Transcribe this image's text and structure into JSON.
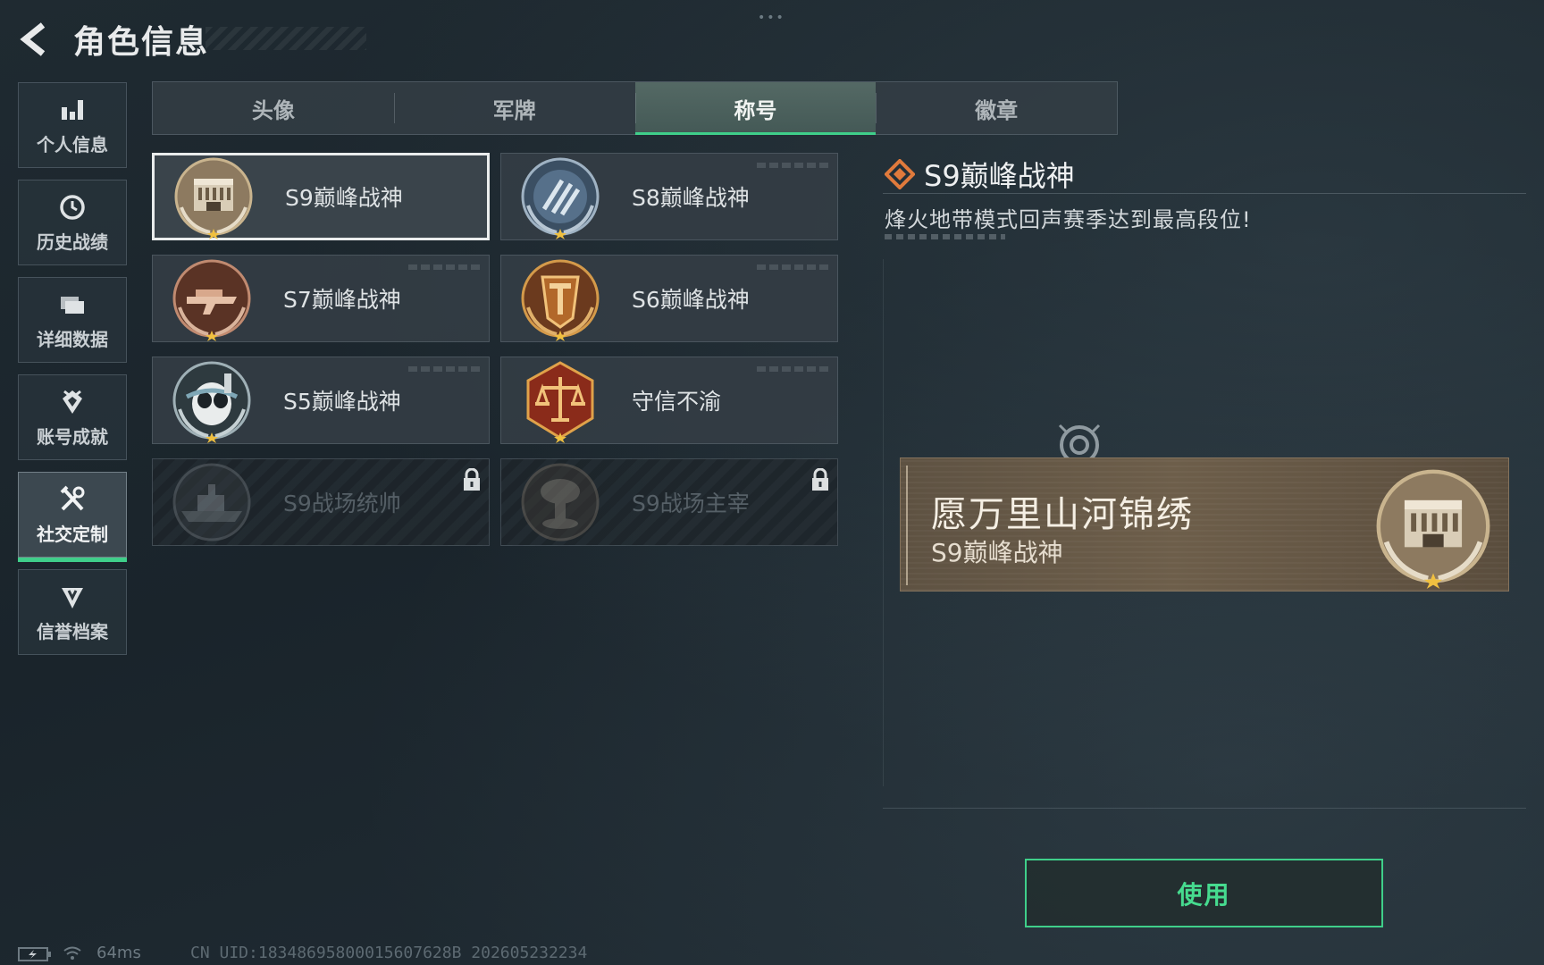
{
  "header": {
    "title": "角色信息",
    "top_dots": "•••"
  },
  "nav": {
    "items": [
      {
        "label": "个人信息",
        "icon": "bar-chart-icon"
      },
      {
        "label": "历史战绩",
        "icon": "history-icon"
      },
      {
        "label": "详细数据",
        "icon": "folders-icon"
      },
      {
        "label": "账号成就",
        "icon": "achievement-icon"
      },
      {
        "label": "社交定制",
        "icon": "tools-icon",
        "active": true
      },
      {
        "label": "信誉档案",
        "icon": "reputation-icon"
      }
    ]
  },
  "tabs": [
    "头像",
    "军牌",
    "称号",
    "徽章"
  ],
  "active_tab": "称号",
  "titles": [
    {
      "label": "S9巅峰战神",
      "icon": "s9-medal-icon",
      "selected": true,
      "locked": false
    },
    {
      "label": "S8巅峰战神",
      "icon": "s8-medal-icon",
      "selected": false,
      "locked": false
    },
    {
      "label": "S7巅峰战神",
      "icon": "s7-medal-icon",
      "selected": false,
      "locked": false
    },
    {
      "label": "S6巅峰战神",
      "icon": "s6-medal-icon",
      "selected": false,
      "locked": false
    },
    {
      "label": "S5巅峰战神",
      "icon": "s5-medal-icon",
      "selected": false,
      "locked": false
    },
    {
      "label": "守信不渝",
      "icon": "scales-medal-icon",
      "selected": false,
      "locked": false
    },
    {
      "label": "S9战场统帅",
      "icon": "warship-medal-icon",
      "selected": false,
      "locked": true
    },
    {
      "label": "S9战场主宰",
      "icon": "mushroom-cloud-medal-icon",
      "selected": false,
      "locked": true
    }
  ],
  "detail": {
    "title": "S9巅峰战神",
    "description": "烽火地带模式回声赛季达到最高段位!"
  },
  "preview": {
    "player_name": "愿万里山河锦绣",
    "title": "S9巅峰战神"
  },
  "use_button": "使用",
  "footer": {
    "ping": "64ms",
    "uid": "CN UID:18348695800015607628B 202605232234"
  },
  "colors": {
    "accent_green": "#3fcf8a",
    "detail_diamond": "#e07a3c",
    "banner_brown": "#6d5e4a"
  }
}
